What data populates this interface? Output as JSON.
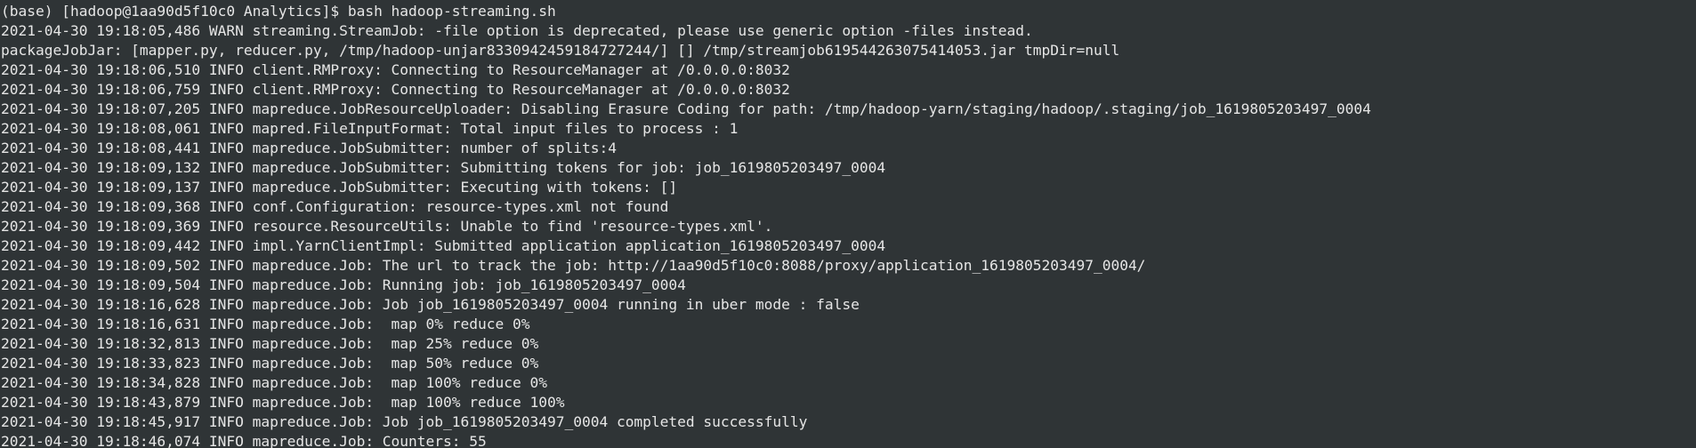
{
  "terminal": {
    "prompt": "(base) [hadoop@1aa90d5f10c0 Analytics]$ ",
    "command": "bash hadoop-streaming.sh",
    "lines": [
      "2021-04-30 19:18:05,486 WARN streaming.StreamJob: -file option is deprecated, please use generic option -files instead.",
      "packageJobJar: [mapper.py, reducer.py, /tmp/hadoop-unjar8330942459184727244/] [] /tmp/streamjob619544263075414053.jar tmpDir=null",
      "2021-04-30 19:18:06,510 INFO client.RMProxy: Connecting to ResourceManager at /0.0.0.0:8032",
      "2021-04-30 19:18:06,759 INFO client.RMProxy: Connecting to ResourceManager at /0.0.0.0:8032",
      "2021-04-30 19:18:07,205 INFO mapreduce.JobResourceUploader: Disabling Erasure Coding for path: /tmp/hadoop-yarn/staging/hadoop/.staging/job_1619805203497_0004",
      "2021-04-30 19:18:08,061 INFO mapred.FileInputFormat: Total input files to process : 1",
      "2021-04-30 19:18:08,441 INFO mapreduce.JobSubmitter: number of splits:4",
      "2021-04-30 19:18:09,132 INFO mapreduce.JobSubmitter: Submitting tokens for job: job_1619805203497_0004",
      "2021-04-30 19:18:09,137 INFO mapreduce.JobSubmitter: Executing with tokens: []",
      "2021-04-30 19:18:09,368 INFO conf.Configuration: resource-types.xml not found",
      "2021-04-30 19:18:09,369 INFO resource.ResourceUtils: Unable to find 'resource-types.xml'.",
      "2021-04-30 19:18:09,442 INFO impl.YarnClientImpl: Submitted application application_1619805203497_0004",
      "2021-04-30 19:18:09,502 INFO mapreduce.Job: The url to track the job: http://1aa90d5f10c0:8088/proxy/application_1619805203497_0004/",
      "2021-04-30 19:18:09,504 INFO mapreduce.Job: Running job: job_1619805203497_0004",
      "2021-04-30 19:18:16,628 INFO mapreduce.Job: Job job_1619805203497_0004 running in uber mode : false",
      "2021-04-30 19:18:16,631 INFO mapreduce.Job:  map 0% reduce 0%",
      "2021-04-30 19:18:32,813 INFO mapreduce.Job:  map 25% reduce 0%",
      "2021-04-30 19:18:33,823 INFO mapreduce.Job:  map 50% reduce 0%",
      "2021-04-30 19:18:34,828 INFO mapreduce.Job:  map 100% reduce 0%",
      "2021-04-30 19:18:43,879 INFO mapreduce.Job:  map 100% reduce 100%",
      "2021-04-30 19:18:45,917 INFO mapreduce.Job: Job job_1619805203497_0004 completed successfully",
      "2021-04-30 19:18:46,074 INFO mapreduce.Job: Counters: 55"
    ],
    "colors": {
      "background": "#2f3436",
      "foreground": "#e6e6e6"
    }
  }
}
